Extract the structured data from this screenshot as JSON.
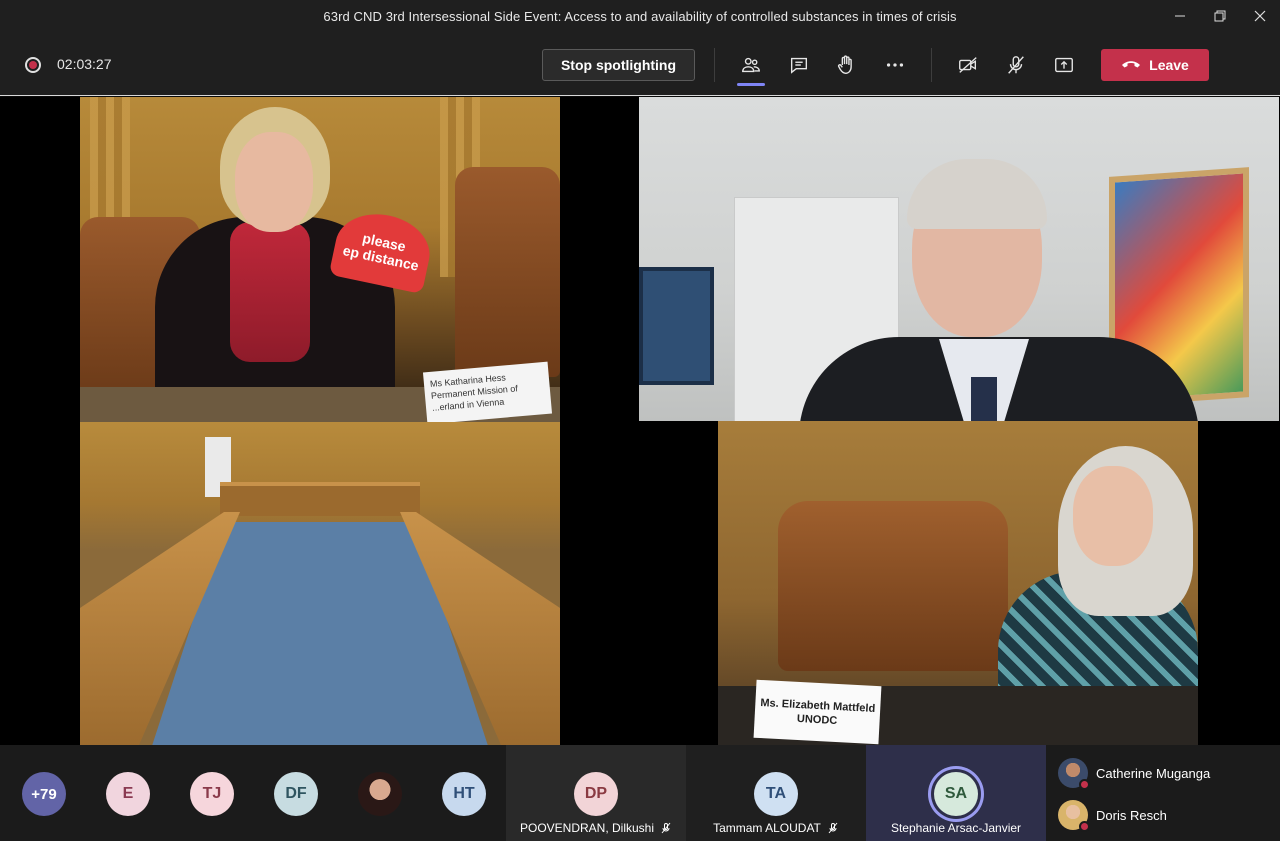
{
  "window": {
    "title": "63rd CND 3rd Intersessional Side Event: Access to and availability of controlled substances in times of crisis"
  },
  "toolbar": {
    "timer": "02:03:27",
    "spotlight_label": "Stop spotlighting",
    "leave_label": "Leave",
    "icons": [
      "participants-icon",
      "chat-icon",
      "raise-hand-icon",
      "more-icon",
      "camera-off-icon",
      "mic-off-icon",
      "share-icon"
    ]
  },
  "stage": {
    "tile1": {
      "sign_text": "please\nep distance",
      "nameplate": "Ms Katharina Hess\nPermanent Mission of\n...erland in Vienna"
    },
    "tile4": {
      "nameplate": "Ms. Elizabeth Mattfeld\nUNODC"
    }
  },
  "strip": {
    "overflow_count": "+79",
    "avatars": [
      "E",
      "TJ",
      "DF",
      "HT"
    ],
    "participants": [
      {
        "initials": "DP",
        "name": "POOVENDRAN, Dilkushi"
      },
      {
        "initials": "TA",
        "name": "Tammam ALOUDAT"
      },
      {
        "initials": "SA",
        "name": "Stephanie Arsac-Janvier"
      }
    ],
    "side_list": [
      {
        "name": "Catherine Muganga"
      },
      {
        "name": "Doris Resch"
      }
    ]
  },
  "colors": {
    "accent": "#6264a7",
    "leave": "#c4314b",
    "active_ring": "#9a9cf0"
  }
}
